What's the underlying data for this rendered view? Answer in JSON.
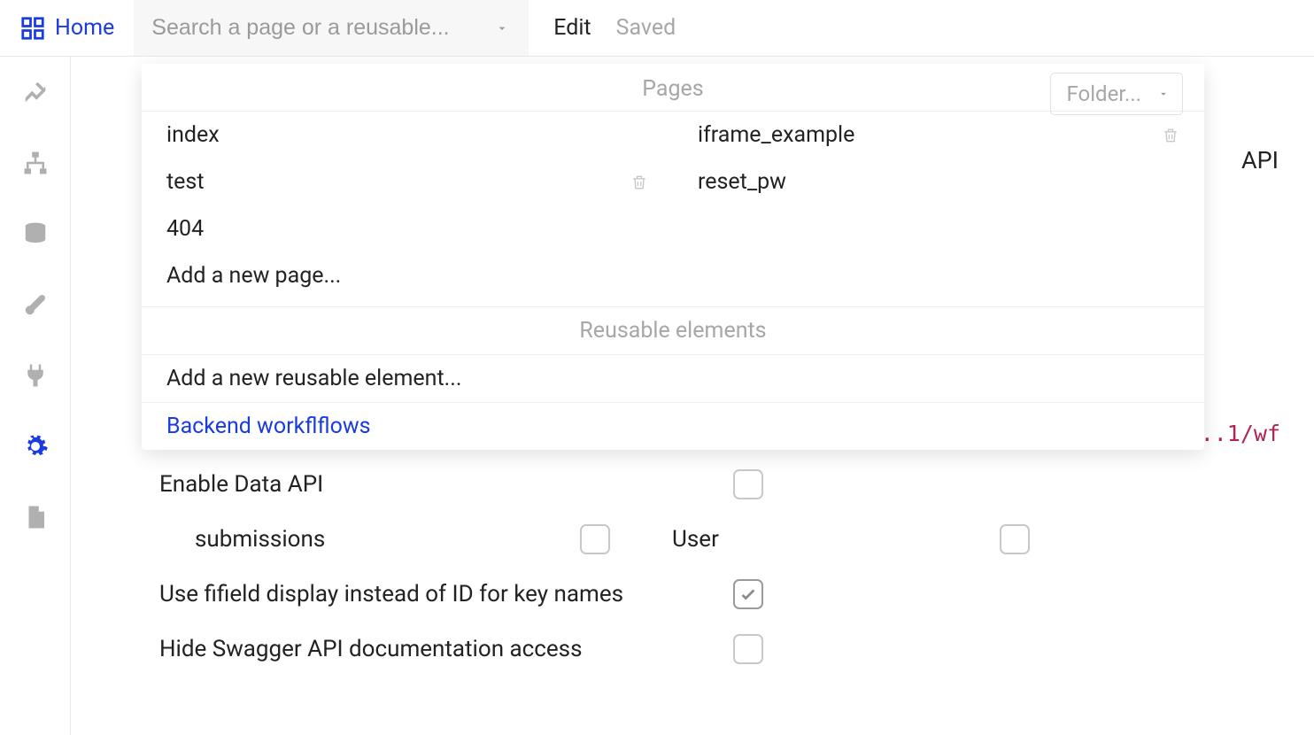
{
  "topbar": {
    "home_label": "Home",
    "search_placeholder": "Search a page or a reusable...",
    "edit_label": "Edit",
    "saved_label": "Saved"
  },
  "dropdown": {
    "pages_header": "Pages",
    "folder_placeholder": "Folder...",
    "pages_left": [
      "index",
      "test",
      "404"
    ],
    "pages_right": [
      "iframe_example",
      "reset_pw"
    ],
    "add_page_label": "Add a new page...",
    "reusable_header": "Reusable elements",
    "add_reusable_label": "Add a new reusable element...",
    "backend_label": "Backend workflflows"
  },
  "background": {
    "api_label": "API",
    "wf_text": "..1/wf"
  },
  "settings": {
    "enable_data_label": "Enable Data API",
    "submissions_label": "submissions",
    "user_label": "User",
    "use_field_label": "Use fifield display instead of ID for key names",
    "hide_swagger_label": "Hide Swagger API documentation access"
  }
}
